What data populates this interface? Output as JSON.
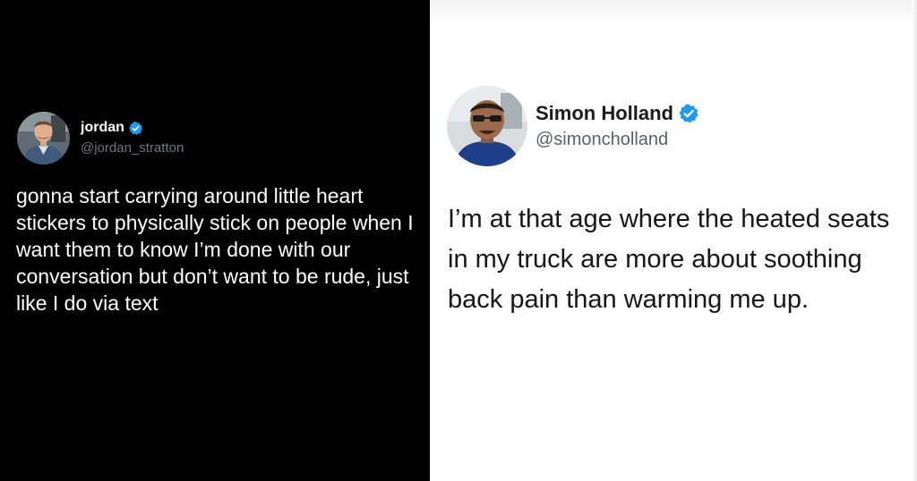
{
  "left_tweet": {
    "theme": "dark",
    "background_color": "#000000",
    "avatar": "user-avatar-photo",
    "display_name": "jordan",
    "verified_icon": "verified-badge-icon",
    "verified_color": "#1d9bf0",
    "handle": "@jordan_stratton",
    "text": "gonna start carrying around little heart stickers to physically stick on people when I want them to know I’m done with our conversation but don’t want to be rude, just like I do via text"
  },
  "right_tweet": {
    "theme": "light",
    "background_color": "#ffffff",
    "avatar": "user-avatar-photo",
    "display_name": "Simon Holland",
    "verified_icon": "verified-badge-icon",
    "verified_color": "#1d9bf0",
    "handle": "@simoncholland",
    "text": "I’m at that age where the heated seats in my truck are more about soothing back pain than warming me up."
  }
}
